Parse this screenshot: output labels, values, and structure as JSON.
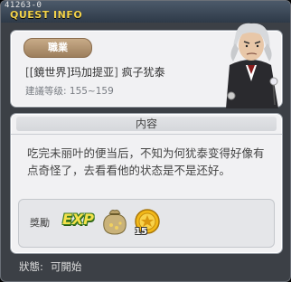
{
  "window": {
    "quest_id": "41263-0",
    "title": "QUEST INFO"
  },
  "info": {
    "job_label": "職業",
    "npc_title_open": "[",
    "npc_title_inner": "[鏡世界]玛加提亚",
    "npc_title_close": "]",
    "npc_name": "疯子犹泰",
    "level_label": "建議等级:",
    "level_range": "155~159"
  },
  "content": {
    "header": "内容",
    "description": "吃完未丽叶的便当后，不知为何犹泰变得好像有点奇怪了，去看看他的状态是不是还好。"
  },
  "reward": {
    "label": "獎勵",
    "exp_label": "EXP",
    "coin_count": "15"
  },
  "status": {
    "label": "狀態:",
    "value": "可開始"
  },
  "colors": {
    "title_yellow": "#f2d24a",
    "panel_bg": "#f1f1f3",
    "window_bg": "#3c4046"
  },
  "icons": [
    "npc-portrait",
    "exp-icon",
    "meso-bag-icon",
    "coin-icon"
  ]
}
